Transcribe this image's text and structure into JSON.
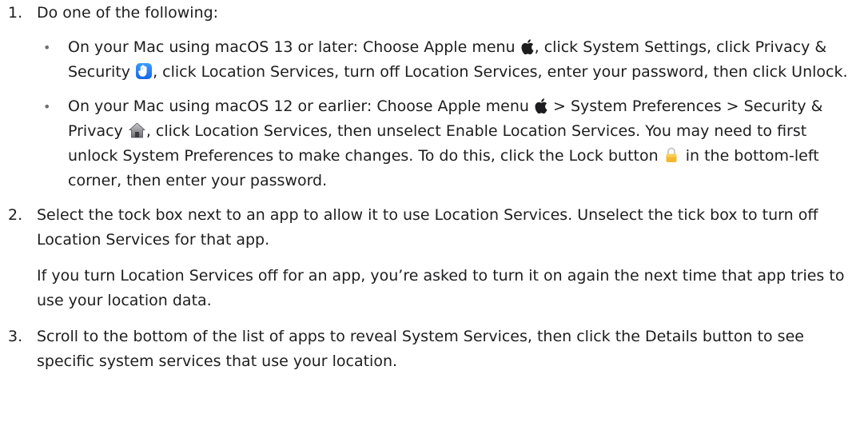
{
  "steps": [
    {
      "number": "1.",
      "text": "Do one of the following:",
      "substeps": [
        {
          "bullet": "•",
          "a": "On your Mac using macOS 13 or later: Choose Apple menu ",
          "icon1": "apple-logo-icon",
          "b": ", click System Settings, click Privacy & Security ",
          "icon2": "privacy-hand-icon",
          "c": ", click Location Services, turn off Location Services, enter your password, then click Unlock."
        },
        {
          "bullet": "•",
          "a": "On your Mac using macOS 12 or earlier: Choose Apple menu ",
          "icon1": "apple-logo-icon",
          "b": " > System Preferences > Security & Privacy ",
          "icon2": "security-house-icon",
          "c": ", click Location Services, then unselect Enable Location Services. You may need to first unlock System Preferences to make changes. To do this, click the Lock button ",
          "icon3": "lock-icon",
          "d": " in the bottom-left corner, then enter your password."
        }
      ]
    },
    {
      "number": "2.",
      "text": "Select the tock box next to an app to allow it to use Location Services. Unselect the tick box to turn off Location Services for that app.",
      "note": "If you turn Location Services off for an app, you’re asked to turn it on again the next time that app tries to use your location data."
    },
    {
      "number": "3.",
      "text": "Scroll to the bottom of the list of apps to reveal System Services, then click the Details button to see specific system services that use your location."
    }
  ],
  "colors": {
    "text": "#1d1d1f",
    "privacy_icon": "#1466e8",
    "lock_icon": "#f5b82e"
  }
}
